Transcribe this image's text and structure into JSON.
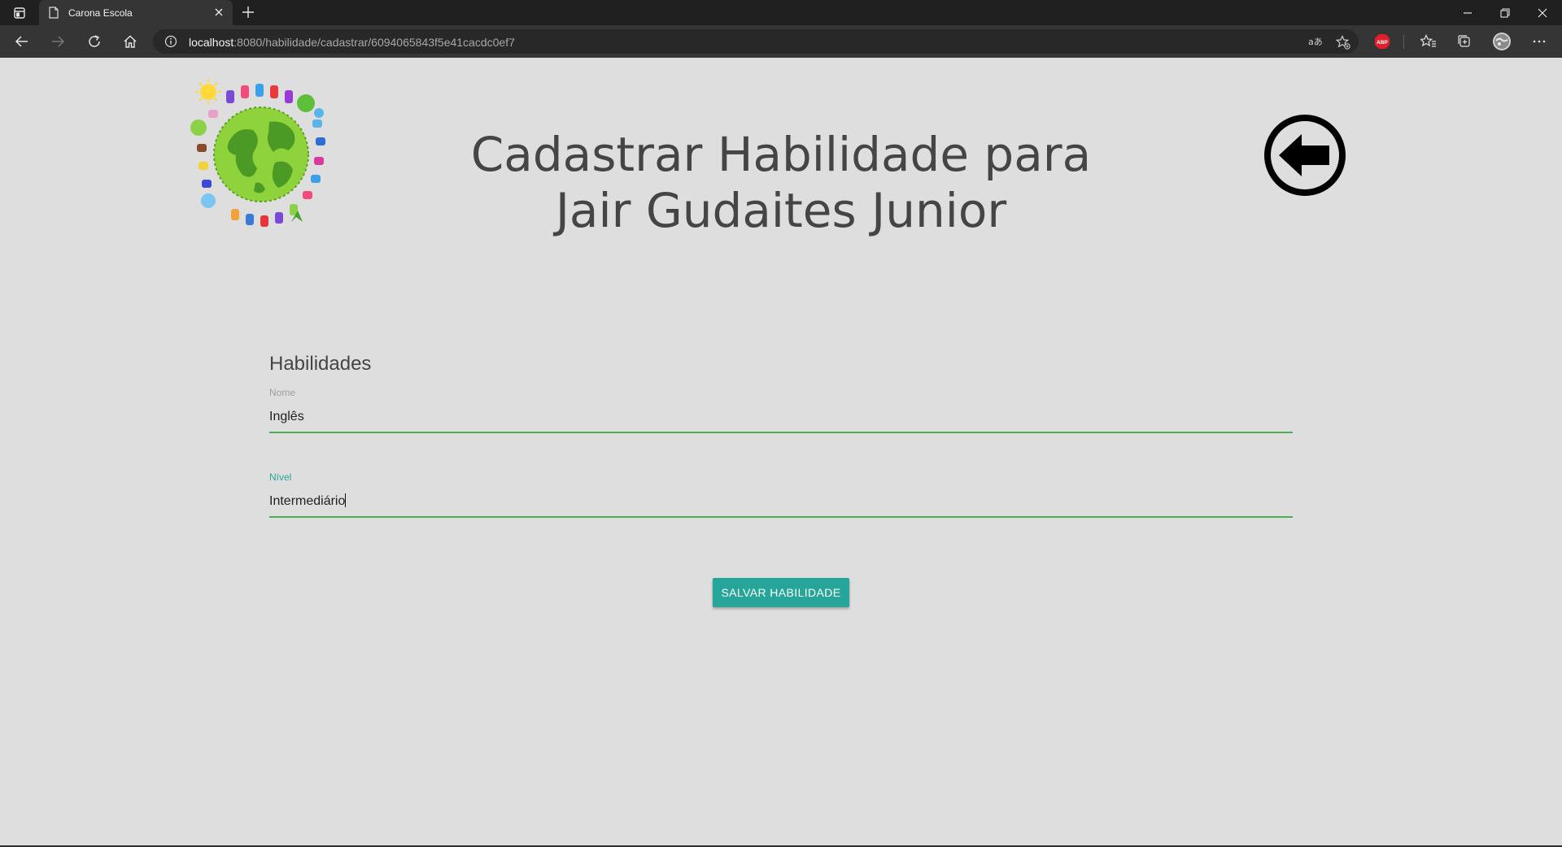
{
  "browser": {
    "tab_title": "Carona Escola",
    "url_host": "localhost",
    "url_rest": ":8080/habilidade/cadastrar/6094065843f5e41cacdc0ef7",
    "adblock_label": "ABP"
  },
  "page": {
    "title": "Cadastrar Habilidade para Jair Gudaites Junior",
    "section_title": "Habilidades",
    "fields": [
      {
        "label": "Nome",
        "value": "Inglês"
      },
      {
        "label": "Nível",
        "value": "Intermediário"
      }
    ],
    "save_label": "SALVAR HABILIDADE"
  },
  "colors": {
    "accent": "#26a69a",
    "field_underline": "#4caf50",
    "background": "#dedede"
  },
  "icons": {
    "logo": "children-around-globe-logo",
    "back": "back-arrow-circle-icon"
  }
}
